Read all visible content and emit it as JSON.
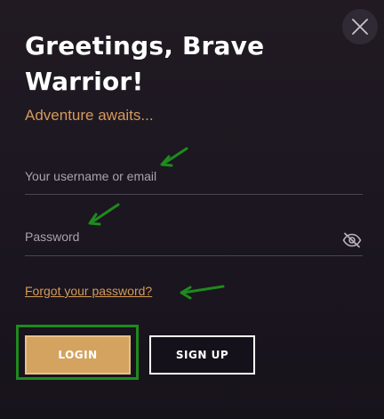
{
  "dialog": {
    "title": "Greetings, Brave Warrior!",
    "subtitle": "Adventure awaits..."
  },
  "form": {
    "username_placeholder": "Your username or email",
    "password_placeholder": "Password",
    "forgot_link": "Forgot your password?"
  },
  "actions": {
    "login_label": "LOGIN",
    "signup_label": "SIGN UP"
  },
  "icons": {
    "close": "close-icon",
    "password_visibility": "eye-slash-icon"
  },
  "colors": {
    "accent": "#d59a5a",
    "login_button": "#d3a35f",
    "annotation": "#1e8a1e"
  }
}
